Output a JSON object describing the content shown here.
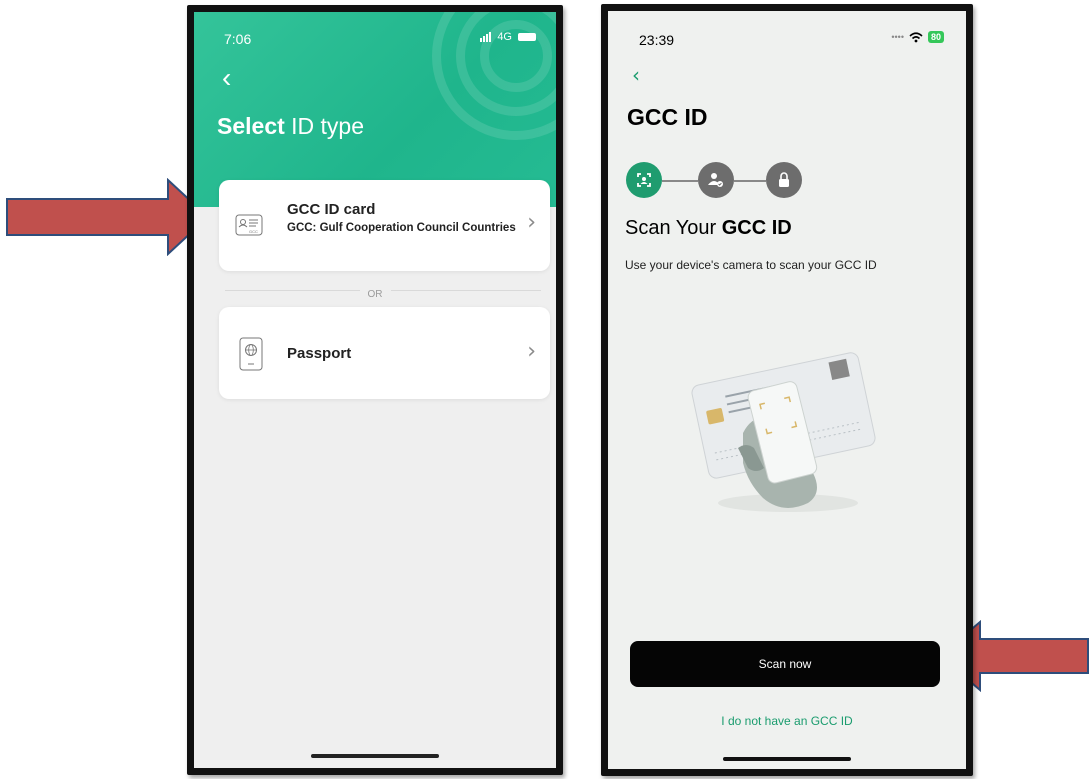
{
  "left_screen": {
    "status_time": "7:06",
    "network": "4G",
    "title_bold": "Select",
    "title_rest": " ID type",
    "gcc_card": {
      "title": "GCC ID card",
      "subtitle": "GCC: Gulf Cooperation Council Countries",
      "icon_label": "GCC"
    },
    "or_label": "OR",
    "passport_card": {
      "title": "Passport"
    }
  },
  "right_screen": {
    "status_time": "23:39",
    "battery": "80",
    "title": "GCC ID",
    "scan_title_normal": "Scan Your ",
    "scan_title_bold": "GCC ID",
    "description": "Use your device's camera to scan your GCC ID",
    "scan_button": "Scan now",
    "no_gcc_link": "I do not have an GCC ID"
  },
  "colors": {
    "brand_green": "#25bb93",
    "link_green": "#1a9c6e",
    "arrow_red": "#c0504d",
    "arrow_border": "#2e4d7b"
  }
}
